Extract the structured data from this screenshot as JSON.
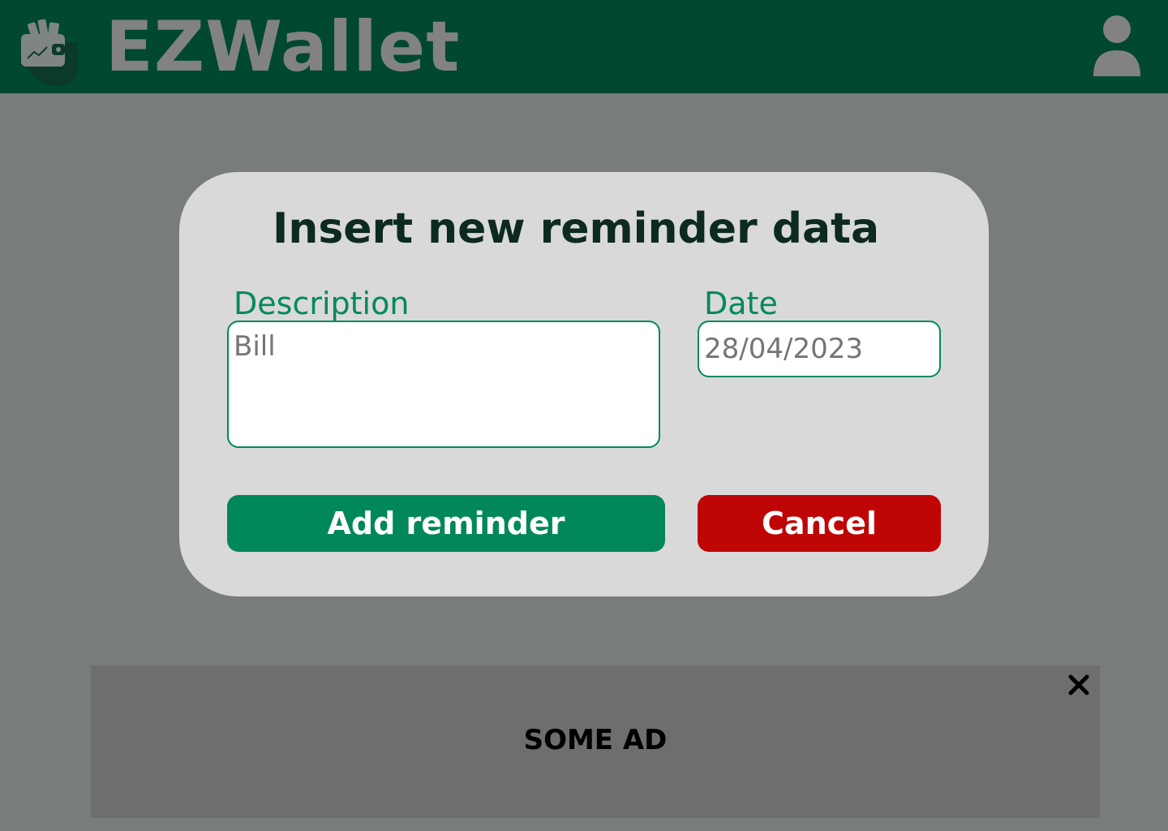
{
  "header": {
    "brand": "EZWallet",
    "logo_icon": "wallet-icon",
    "user_icon": "user-icon"
  },
  "dialog": {
    "title": "Insert new reminder data",
    "description_label": "Description",
    "description_placeholder": "Bill",
    "date_label": "Date",
    "date_placeholder": "28/04/2023",
    "add_button": "Add reminder",
    "cancel_button": "Cancel"
  },
  "ad": {
    "text": "SOME AD",
    "close_icon": "close-icon"
  },
  "colors": {
    "header_bg": "#004830",
    "overlay": "#787d7c",
    "dialog_bg": "#d9d9d9",
    "accent_green": "#00875a",
    "cancel_red": "#bf0505",
    "ad_bg": "#6e6e6e"
  }
}
